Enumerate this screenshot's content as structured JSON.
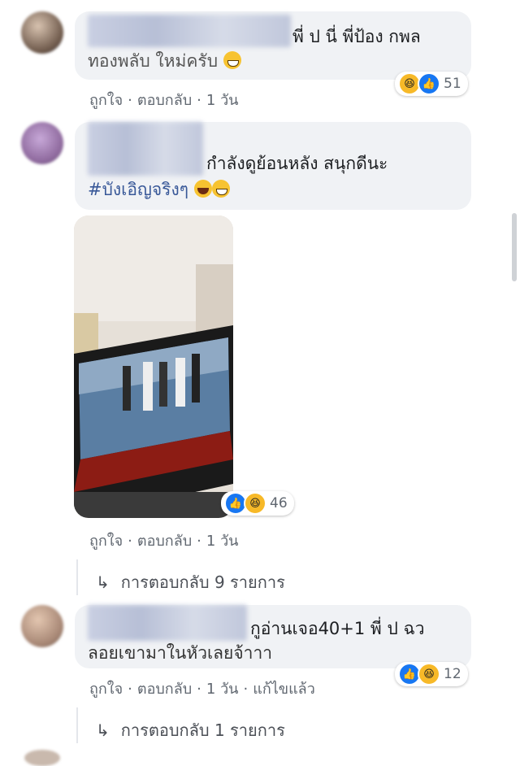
{
  "comments": [
    {
      "text_line1": "พี่ ป นี่ พี่ป้อง กพล",
      "text_line2": "ทองพลับ ใหม่ครับ",
      "emoji1": "grin-emoji",
      "actions": {
        "like": "ถูกใจ",
        "reply": "ตอบกลับ",
        "time": "1 วัน"
      },
      "reactions": {
        "icons": [
          "haha",
          "like"
        ],
        "count": "51"
      }
    },
    {
      "text_line1": "กำลังดูย้อนหลัง สนุกดีนะ",
      "hashtag": "#บังเอิญจริงๆ",
      "actions": {
        "like": "ถูกใจ",
        "reply": "ตอบกลับ",
        "time": "1 วัน"
      },
      "reactions": {
        "icons": [
          "like",
          "haha"
        ],
        "count": "46"
      },
      "replies": "การตอบกลับ 9 รายการ"
    },
    {
      "text_line1": "กูอ่านเจอ40+1 พี่ ป ฉว",
      "text_line2": "ลอยเขามาในหัวเลยจ้าาา",
      "actions": {
        "like": "ถูกใจ",
        "reply": "ตอบกลับ",
        "time": "1 วัน",
        "edited": "แก้ไขแล้ว"
      },
      "reactions": {
        "icons": [
          "like",
          "haha"
        ],
        "count": "12"
      },
      "replies": "การตอบกลับ 1 รายการ"
    }
  ],
  "icons": {
    "reply_arrow": "reply-arrow-icon"
  },
  "colors": {
    "bubble": "#f0f2f5",
    "hashtag": "#385898",
    "like": "#1877f2",
    "haha": "#f7b928"
  }
}
